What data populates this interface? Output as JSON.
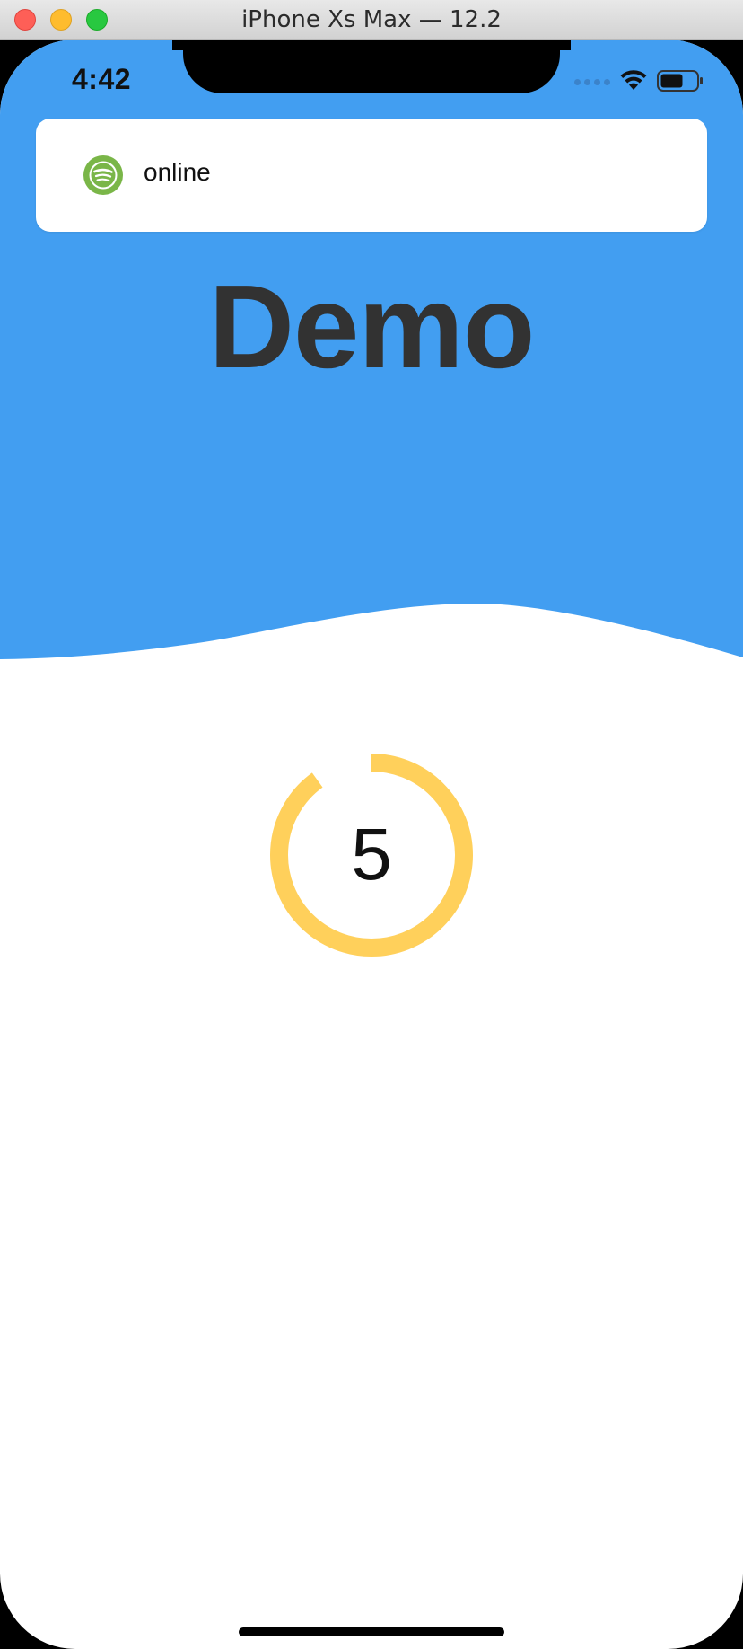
{
  "window": {
    "title": "iPhone Xs Max — 12.2"
  },
  "status_bar": {
    "time": "4:42",
    "icons": [
      "signal-dots-icon",
      "wifi-icon",
      "battery-icon"
    ]
  },
  "notification": {
    "icon": "spotify-icon",
    "text": "online"
  },
  "hero": {
    "title": "Demo"
  },
  "countdown": {
    "value": "5",
    "progress": 0.9
  },
  "colors": {
    "header_blue": "#429EF1",
    "ring_yellow": "#FFD05B",
    "spotify_green": "#7AB648",
    "title_text": "#323232"
  }
}
